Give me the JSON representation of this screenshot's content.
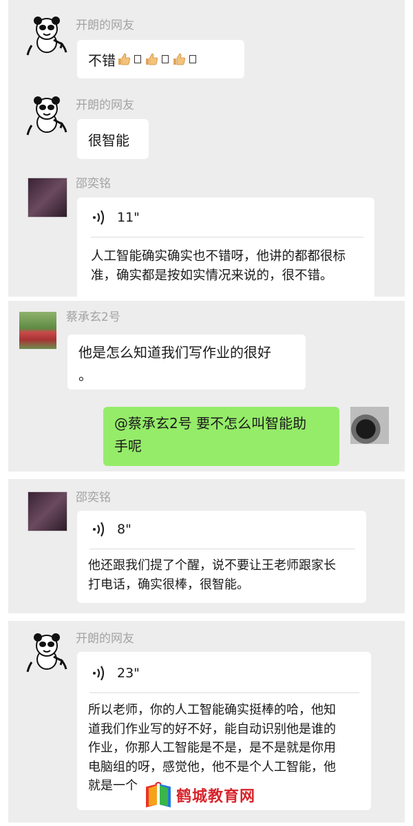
{
  "messages": {
    "m1": {
      "sender": "开朗的网友",
      "text": "不错"
    },
    "m2": {
      "sender": "开朗的网友",
      "text": "很智能"
    },
    "m3": {
      "sender": "邵奕铭",
      "duration": "11\"",
      "transcript_l1": "人工智能确实确实也不错呀，他讲的都都很标",
      "transcript_l2": "准，确实都是按如实情况来说的，很不错。"
    },
    "m4": {
      "sender": "蔡承玄2号",
      "line1": "他是怎么知道我们写作业的很好",
      "line2": "。"
    },
    "m5": {
      "line1": "@蔡承玄2号 要不怎么叫智能助",
      "line2": "手呢"
    },
    "m6": {
      "sender": "邵奕铭",
      "duration": "8\"",
      "transcript_l1": "他还跟我们提了个醒，说不要让王老师跟家长",
      "transcript_l2": "打电话，确实很棒，很智能。"
    },
    "m7": {
      "sender": "开朗的网友",
      "duration": "23\"",
      "lines": [
        "所以老师，你的人工智能确实挺棒的哈，他知",
        "道我们作业写的好不好，能自动识别他是谁的",
        "作业，你那人工智能是不是，是不是就是你用",
        "电脑组的呀，感觉他，他不是个人工智能，他",
        "就是一个"
      ]
    }
  },
  "watermark": {
    "text": "鹤城教育网"
  },
  "colors": {
    "panel_bg": "#ededed",
    "bubble_bg": "#ffffff",
    "self_bubble": "#95ec69",
    "name": "#a3a3a3",
    "watermark": "#d8232a"
  }
}
